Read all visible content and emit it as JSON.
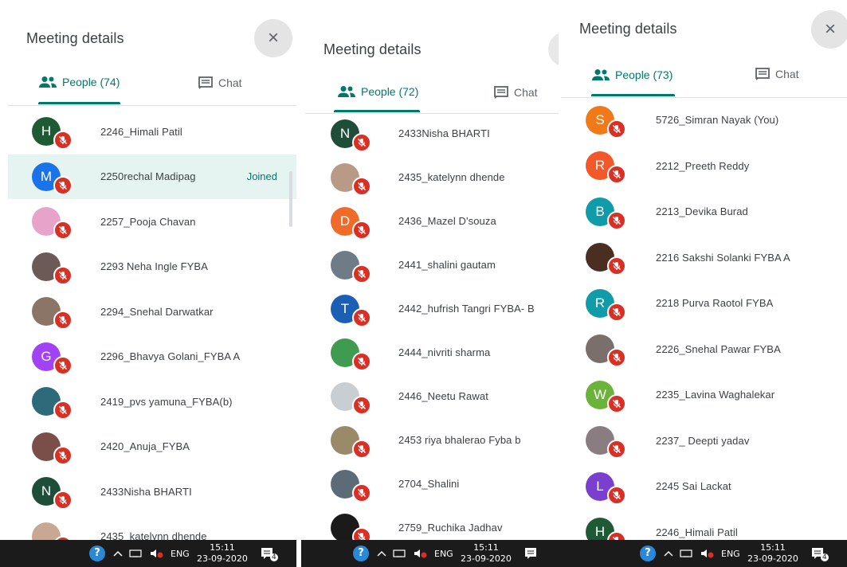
{
  "panels": [
    {
      "title": "Meeting details",
      "tabs": {
        "people": "People (74)",
        "chat": "Chat"
      },
      "close_glyph": "×",
      "participants": [
        {
          "name": "2246_Himali Patil",
          "initial": "H",
          "color": "#1e5b35"
        },
        {
          "name": "2250rechal Madipag",
          "initial": "M",
          "color": "#1a73e8",
          "status": "Joined"
        },
        {
          "name": "2257_Pooja Chavan",
          "initial": "",
          "color": "#e7a3c9"
        },
        {
          "name": "2293 Neha Ingle FYBA",
          "initial": "",
          "color": "#6b5a55"
        },
        {
          "name": "2294_Snehal Darwatkar",
          "initial": "",
          "color": "#8a7567"
        },
        {
          "name": "2296_Bhavya Golani_FYBA A",
          "initial": "G",
          "color": "#a142f4"
        },
        {
          "name": "2419_pvs yamuna_FYBA(b)",
          "initial": "",
          "color": "#2e6b7a"
        },
        {
          "name": "2420_Anuja_FYBA",
          "initial": "",
          "color": "#7a4f4a"
        },
        {
          "name": "2433Nisha BHARTI",
          "initial": "N",
          "color": "#1e4d3a"
        },
        {
          "name": "2435_katelynn dhende",
          "initial": "",
          "color": "#c8a892"
        }
      ]
    },
    {
      "title": "Meeting details",
      "tabs": {
        "people": "People (72)",
        "chat": "Chat"
      },
      "participants": [
        {
          "name": "2433Nisha BHARTI",
          "initial": "N",
          "color": "#1e4d3a"
        },
        {
          "name": "2435_katelynn dhende",
          "initial": "",
          "color": "#b89a86"
        },
        {
          "name": "2436_Mazel D'souza",
          "initial": "D",
          "color": "#f06a2a"
        },
        {
          "name": "2441_shalini gautam",
          "initial": "",
          "color": "#6f7b86"
        },
        {
          "name": "2442_hufrish Tangri FYBA- B",
          "initial": "T",
          "color": "#1a5fb4"
        },
        {
          "name": "2444_nivriti sharma",
          "initial": "",
          "color": "#3f9b4f"
        },
        {
          "name": "2446_Neetu Rawat",
          "initial": "",
          "color": "#c9ced2"
        },
        {
          "name": "2453 riya bhalerao Fyba b",
          "initial": "",
          "color": "#9b8a6a"
        },
        {
          "name": "2704_Shalini",
          "initial": "",
          "color": "#5b6b78"
        },
        {
          "name": "2759_Ruchika Jadhav",
          "initial": "",
          "color": "#1a1a1a"
        }
      ]
    },
    {
      "title": "Meeting details",
      "tabs": {
        "people": "People (73)",
        "chat": "Chat"
      },
      "close_glyph": "×",
      "participants": [
        {
          "name": "5726_Simran Nayak (You)",
          "initial": "S",
          "color": "#f07a1a"
        },
        {
          "name": "2212_Preeth Reddy",
          "initial": "R",
          "color": "#f2582a"
        },
        {
          "name": "2213_Devika Burad",
          "initial": "B",
          "color": "#0f9ba8"
        },
        {
          "name": "2216 Sakshi Solanki FYBA A",
          "initial": "",
          "color": "#4a2e22"
        },
        {
          "name": "2218 Purva Raotol FYBA",
          "initial": "R",
          "color": "#0f9ba8"
        },
        {
          "name": "2226_Snehal Pawar FYBA",
          "initial": "",
          "color": "#7a6f6a"
        },
        {
          "name": "2235_Lavina Waghalekar",
          "initial": "W",
          "color": "#6bb33a"
        },
        {
          "name": "2237_ Deepti yadav",
          "initial": "",
          "color": "#8a7d82"
        },
        {
          "name": "2245 Sai Lackat",
          "initial": "L",
          "color": "#7b3fd0"
        },
        {
          "name": "2246_Himali Patil",
          "initial": "H",
          "color": "#1e5b35"
        }
      ]
    }
  ],
  "taskbars": [
    {
      "lang": "ENG",
      "time": "15:11",
      "date": "23-09-2020",
      "notif": "4"
    },
    {
      "lang": "ENG",
      "time": "15:11",
      "date": "23-09-2020",
      "notif": ""
    },
    {
      "lang": "ENG",
      "time": "15:11",
      "date": "23-09-2020",
      "notif": "4"
    }
  ]
}
